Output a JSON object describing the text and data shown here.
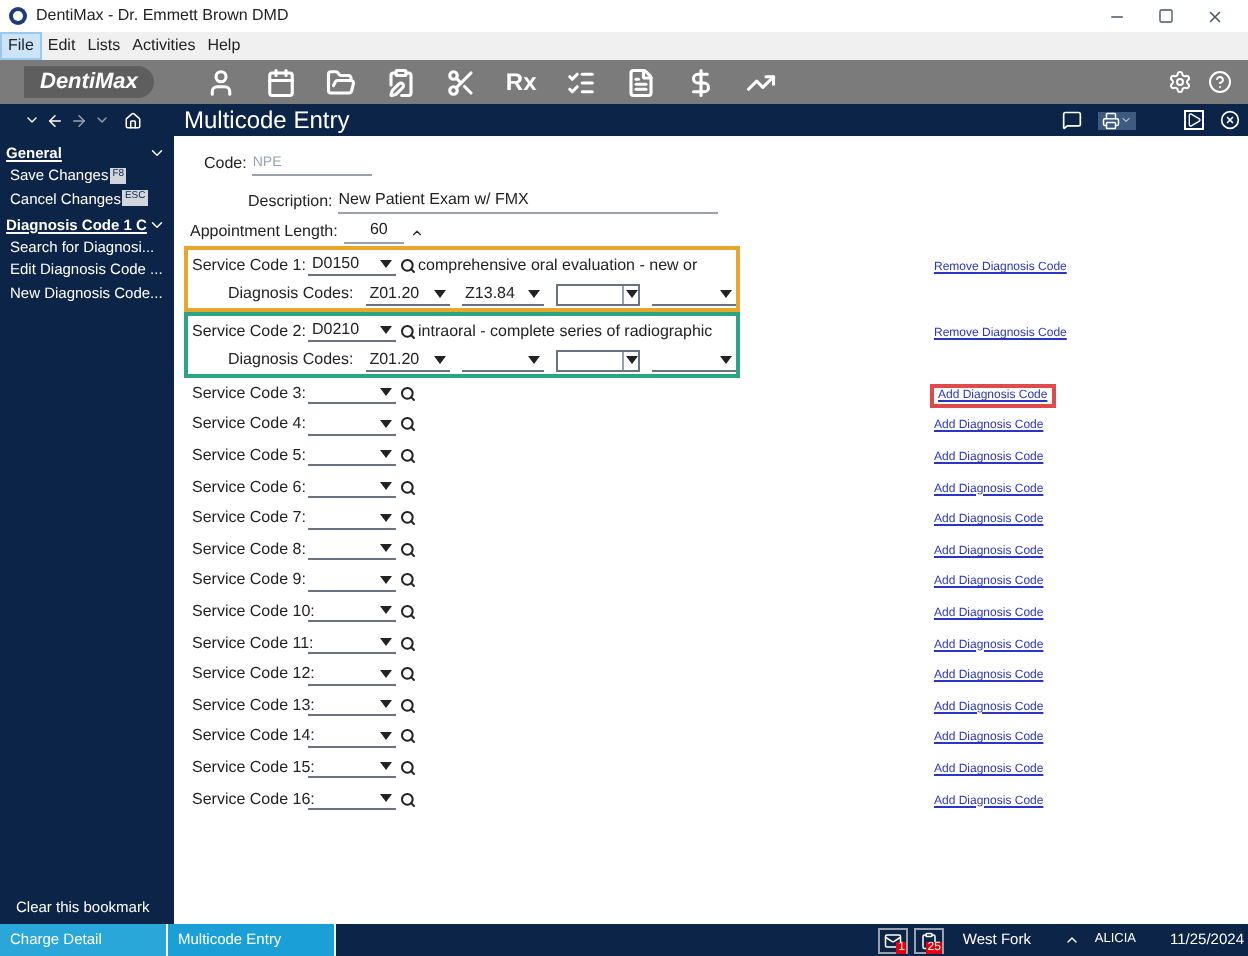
{
  "window": {
    "title": "DentiMax - Dr. Emmett Brown DMD"
  },
  "menu": [
    {
      "label": "File",
      "selected": true
    },
    {
      "label": "Edit",
      "selected": false
    },
    {
      "label": "Lists",
      "selected": false
    },
    {
      "label": "Activities",
      "selected": false
    },
    {
      "label": "Help",
      "selected": false
    }
  ],
  "toolbar": {
    "logo": "DentiMax",
    "rx": "Rx"
  },
  "page_title": "Multicode Entry",
  "sidebar": {
    "sections": [
      {
        "title": "General",
        "items": [
          {
            "label": "Save Changes",
            "key": "F8"
          },
          {
            "label": "Cancel Changes",
            "key": "ESC"
          }
        ]
      },
      {
        "title": "Diagnosis Code 1 C",
        "items": [
          {
            "label": "Search for Diagnosi..."
          },
          {
            "label": "Edit Diagnosis Code ..."
          },
          {
            "label": "New Diagnosis Code..."
          }
        ]
      }
    ],
    "footer": "Clear this bookmark"
  },
  "form": {
    "code_label": "Code:",
    "code_placeholder": "NPE",
    "description_label": "Description:",
    "description": "New Patient Exam w/ FMX",
    "length_label": "Appointment Length:",
    "length": "60"
  },
  "service_codes": [
    {
      "label": "Service Code 1:",
      "code": "D0150",
      "description": "comprehensive oral evaluation - new or",
      "color": "#e8a62c",
      "diagnosis_label": "Diagnosis Codes:",
      "diagnosis_codes": [
        {
          "value": "Z01.20",
          "kind": "line"
        },
        {
          "value": "Z13.84",
          "kind": "line"
        },
        {
          "kind": "box"
        },
        {
          "kind": "line"
        }
      ],
      "link": "Remove Diagnosis Code"
    },
    {
      "label": "Service Code 2:",
      "code": "D0210",
      "description": "intraoral - complete series of radiographic",
      "color": "#2aa584",
      "diagnosis_label": "Diagnosis Codes:",
      "diagnosis_codes": [
        {
          "value": "Z01.20",
          "kind": "line"
        },
        {
          "kind": "line"
        },
        {
          "kind": "box"
        },
        {
          "kind": "line"
        }
      ],
      "link": "Remove Diagnosis Code"
    },
    {
      "label": "Service Code 3:",
      "link": "Add Diagnosis Code",
      "color": "#e04a4a"
    },
    {
      "label": "Service Code 4:",
      "link": "Add Diagnosis Code"
    },
    {
      "label": "Service Code 5:",
      "link": "Add Diagnosis Code"
    },
    {
      "label": "Service Code 6:",
      "link": "Add Diagnosis Code"
    },
    {
      "label": "Service Code 7:",
      "link": "Add Diagnosis Code"
    },
    {
      "label": "Service Code 8:",
      "link": "Add Diagnosis Code"
    },
    {
      "label": "Service Code 9:",
      "link": "Add Diagnosis Code"
    },
    {
      "label": "Service Code 10:",
      "link": "Add Diagnosis Code"
    },
    {
      "label": "Service Code 11:",
      "link": "Add Diagnosis Code"
    },
    {
      "label": "Service Code 12:",
      "link": "Add Diagnosis Code"
    },
    {
      "label": "Service Code 13:",
      "link": "Add Diagnosis Code"
    },
    {
      "label": "Service Code 14:",
      "link": "Add Diagnosis Code"
    },
    {
      "label": "Service Code 15:",
      "link": "Add Diagnosis Code"
    },
    {
      "label": "Service Code 16:",
      "link": "Add Diagnosis Code"
    }
  ],
  "status_bar": {
    "tabs": [
      {
        "label": "Charge Detail",
        "selected": false
      },
      {
        "label": "Multicode Entry",
        "selected": true
      }
    ],
    "messages_badge": "1",
    "tasks_badge": "25",
    "location": "West Fork",
    "user": "ALICIA",
    "date": "11/25/2024"
  }
}
